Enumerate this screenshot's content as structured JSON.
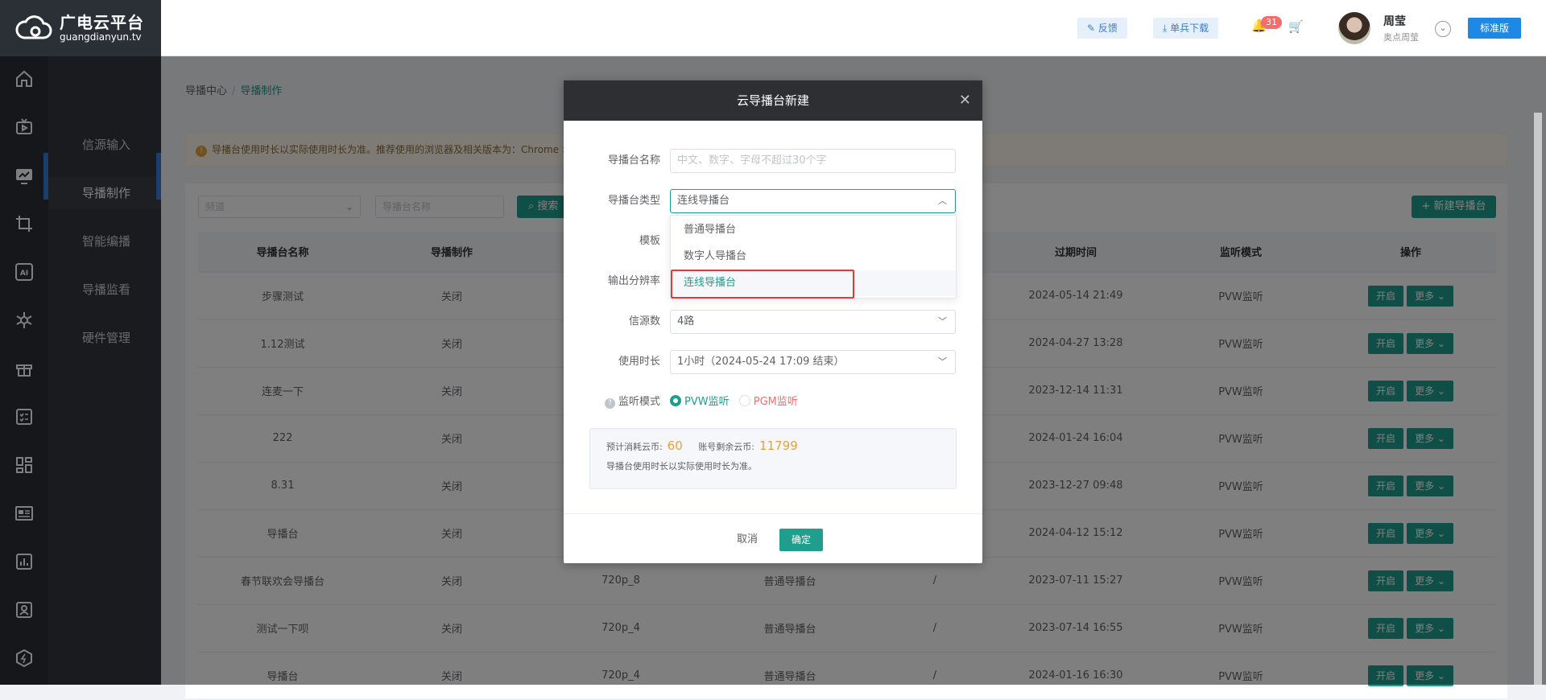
{
  "brand": {
    "name": "广电云平台",
    "domain": "guangdianyun.tv"
  },
  "topbar": {
    "feedback_label": "反馈",
    "download_label": "单兵下载",
    "notification_count": "31",
    "user_name": "周莹",
    "user_sub": "奥点周莹",
    "plan_label": "标准版"
  },
  "icon_sidebar": [
    "home-icon",
    "tv-icon",
    "director-icon",
    "crop-icon",
    "ai-icon",
    "network-icon",
    "gift-icon",
    "checklist-icon",
    "grid-icon",
    "news-icon",
    "chart-icon",
    "contact-icon",
    "hexagon-icon"
  ],
  "submenu": {
    "items": [
      {
        "label": "信源输入"
      },
      {
        "label": "导播制作"
      },
      {
        "label": "智能编播"
      },
      {
        "label": "导播监看"
      },
      {
        "label": "硬件管理"
      }
    ]
  },
  "breadcrumb": {
    "root": "导播中心",
    "current": "导播制作"
  },
  "notice": {
    "text": "导播台使用时长以实际使用时长为准。推荐使用的浏览器及相关版本为：Chrome >"
  },
  "filters": {
    "channel_placeholder": "频道",
    "name_placeholder": "导播台名称",
    "search_label": "搜索",
    "new_label": "+ 新建导播台"
  },
  "table": {
    "columns": [
      "导播台名称",
      "导播制作",
      "",
      "",
      "",
      "过期时间",
      "监听模式",
      "操作"
    ],
    "rows": [
      {
        "name": "步骤测试",
        "status": "关闭",
        "res": "",
        "type": "",
        "x": "",
        "expire": "2024-05-14 21:49",
        "mode": "PVW监听"
      },
      {
        "name": "1.12测试",
        "status": "关闭",
        "res": "",
        "type": "",
        "x": "",
        "expire": "2024-04-27 13:28",
        "mode": "PVW监听"
      },
      {
        "name": "连麦一下",
        "status": "关闭",
        "res": "",
        "type": "",
        "x": "",
        "expire": "2023-12-14 11:31",
        "mode": "PVW监听"
      },
      {
        "name": "222",
        "status": "关闭",
        "res": "",
        "type": "",
        "x": "",
        "expire": "2024-01-24 16:04",
        "mode": "PVW监听"
      },
      {
        "name": "8.31",
        "status": "关闭",
        "res": "",
        "type": "",
        "x": "",
        "expire": "2023-12-27 09:48",
        "mode": "PVW监听"
      },
      {
        "name": "导播台",
        "status": "关闭",
        "res": "",
        "type": "",
        "x": "",
        "expire": "2024-04-12 15:12",
        "mode": "PVW监听"
      },
      {
        "name": "春节联欢会导播台",
        "status": "关闭",
        "res": "720p_8",
        "type": "普通导播台",
        "x": "/",
        "expire": "2023-07-11 15:27",
        "mode": "PVW监听"
      },
      {
        "name": "测试一下呗",
        "status": "关闭",
        "res": "720p_4",
        "type": "普通导播台",
        "x": "/",
        "expire": "2023-07-14 16:55",
        "mode": "PVW监听"
      },
      {
        "name": "导播台",
        "status": "关闭",
        "res": "720p_4",
        "type": "普通导播台",
        "x": "/",
        "expire": "2024-01-16 16:30",
        "mode": "PVW监听"
      }
    ],
    "open_label": "开启",
    "more_label": "更多 ⌄"
  },
  "dialog": {
    "title": "云导播台新建",
    "name_label": "导播台名称",
    "name_placeholder": "中文、数字、字母不超过30个字",
    "type_label": "导播台类型",
    "type_value": "连线导播台",
    "template_label": "模板",
    "resolution_label": "输出分辨率",
    "sources_label": "信源数",
    "sources_value": "4路",
    "duration_label": "使用时长",
    "duration_value": "1小时（2024-05-24 17:09 结束）",
    "monitor_label": "监听模式",
    "monitor_options": [
      "PVW监听",
      "PGM监听"
    ],
    "cost_label": "预计消耗云币:",
    "cost_value": "60",
    "balance_label": "账号剩余云币:",
    "balance_value": "11799",
    "cost_note": "导播台使用时长以实际使用时长为准。",
    "cancel_label": "取消",
    "ok_label": "确定",
    "type_options": [
      "普通导播台",
      "数字人导播台",
      "连线导播台"
    ]
  },
  "colors": {
    "accent": "#1f9e8e",
    "brand_blue": "#1e88e5",
    "highlight": "#e53935"
  }
}
